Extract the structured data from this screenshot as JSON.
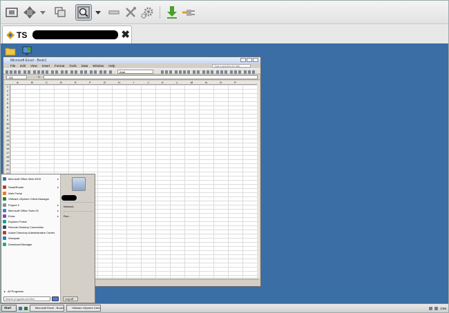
{
  "tab": {
    "label": "TS"
  },
  "excel": {
    "title": "Microsoft Excel - Book1",
    "menu": [
      "File",
      "Edit",
      "View",
      "Insert",
      "Format",
      "Tools",
      "Data",
      "Window",
      "Help"
    ],
    "help_placeholder": "Type a question for help",
    "font_box": "Arial",
    "name_box": "A1",
    "fx": "fx",
    "columns": [
      "A",
      "B",
      "C",
      "D",
      "E",
      "F",
      "G",
      "H",
      "I",
      "J",
      "K",
      "L",
      "M",
      "N",
      "O",
      "P"
    ],
    "rows": [
      "1",
      "2",
      "3",
      "4",
      "5",
      "6",
      "7",
      "8",
      "9",
      "10",
      "11",
      "12",
      "13",
      "14",
      "15",
      "16",
      "17",
      "18",
      "19",
      "20",
      "21",
      "22",
      "23",
      "24"
    ]
  },
  "start_menu": {
    "items": [
      {
        "label": "Microsoft Office Web 2003",
        "arrow": true,
        "color": "#3a6ea5"
      },
      {
        "label": "SmartRoster",
        "arrow": true,
        "color": "#c0392b"
      },
      {
        "label": "Web Portal",
        "arrow": false,
        "color": "#e67e22"
      },
      {
        "label": "VMware vSphere Client-Manager",
        "arrow": false,
        "color": "#2c7a3b"
      },
      {
        "label": "Project 3",
        "arrow": true,
        "color": "#7f8c8d"
      },
      {
        "label": "Microsoft Office Tools 03",
        "arrow": true,
        "color": "#2e86de"
      },
      {
        "label": "Extra",
        "arrow": true,
        "color": "#8e44ad"
      },
      {
        "label": "Explorer Portal",
        "arrow": false,
        "color": "#16a085"
      },
      {
        "label": "Remote Desktop Connection",
        "arrow": false,
        "color": "#34495e"
      },
      {
        "label": "Active Directory Administrative Center",
        "arrow": false,
        "color": "#c0392b"
      },
      {
        "label": "Wordpad",
        "arrow": false,
        "color": "#2980b9"
      },
      {
        "label": "Download Manager",
        "arrow": false,
        "color": "#27ae60"
      }
    ],
    "all_programs": "All Programs",
    "search_placeholder": "Search programs and files",
    "right_items": [
      "Network",
      "Run..."
    ],
    "shutdown": "Log off"
  },
  "taskbar": {
    "start": "Start",
    "tasks": [
      "Microsoft Excel - Book1",
      "VMware vSphere Client"
    ],
    "clock": "3:56"
  }
}
